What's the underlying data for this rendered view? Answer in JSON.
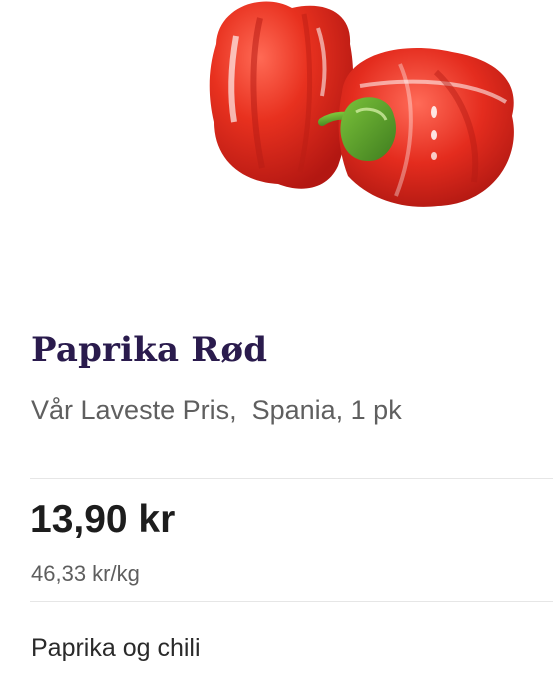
{
  "product": {
    "image_icon": "red-bell-pepper-image",
    "title": "Paprika Rød",
    "subtitle": "Vår Laveste Pris,  Spania, 1 pk",
    "price": "13,90 kr",
    "unit_price": "46,33 kr/kg",
    "category": "Paprika og chili"
  },
  "colors": {
    "title": "#2a1b4d",
    "pepper_red": "#e53227",
    "stem_green": "#5aa02c"
  }
}
